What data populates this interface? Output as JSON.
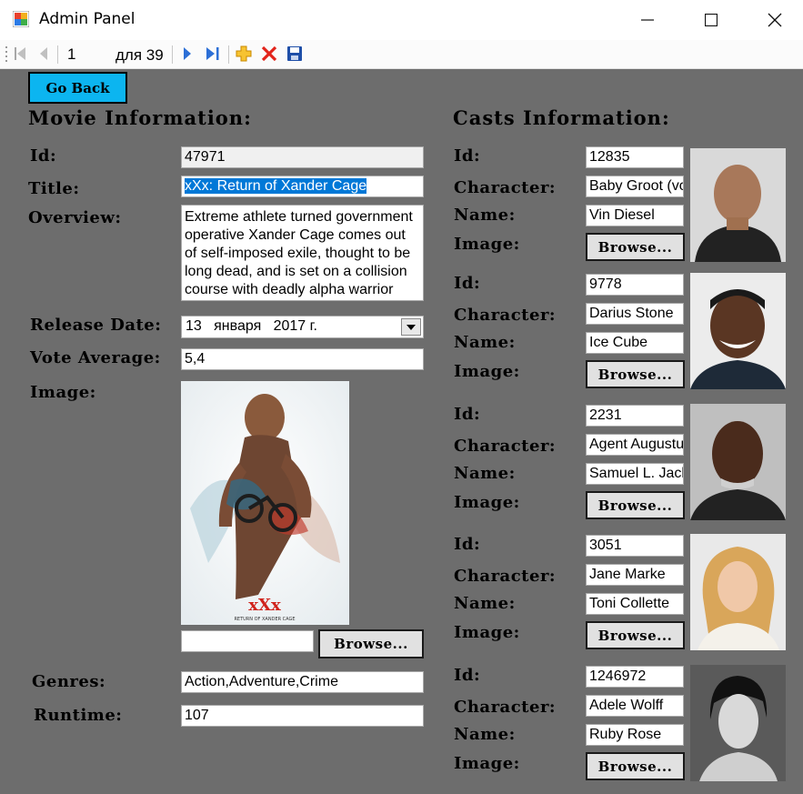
{
  "window": {
    "title": "Admin Panel",
    "minimize": "—",
    "maximize": "☐",
    "close": "✕"
  },
  "toolbar": {
    "position": "1",
    "count_label": "для 39"
  },
  "go_back": "Go Back",
  "movie": {
    "heading": "Movie Information:",
    "id_label": "Id:",
    "id": "47971",
    "title_label": "Title:",
    "title": "xXx: Return of Xander Cage",
    "overview_label": "Overview:",
    "overview": "Extreme athlete turned government operative Xander Cage comes out of self-imposed exile, thought to be long dead, and is set on a collision course with deadly alpha warrior",
    "release_label": "Release Date:",
    "release_date": "13   января   2017 г.",
    "vote_label": "Vote Average:",
    "vote": "5,4",
    "image_label": "Image:",
    "poster_logo": "xXx",
    "poster_caption": "RETURN OF XANDER CAGE",
    "image_path": "",
    "browse": "Browse...",
    "genres_label": "Genres:",
    "genres": "Action,Adventure,Crime",
    "runtime_label": "Runtime:",
    "runtime": "107"
  },
  "casts": {
    "heading": "Casts Information:",
    "id_label": "Id:",
    "character_label": "Character:",
    "name_label": "Name:",
    "image_label": "Image:",
    "browse": "Browse...",
    "items": [
      {
        "id": "12835",
        "character": "Baby Groot (vo",
        "name": "Vin Diesel"
      },
      {
        "id": "9778",
        "character": "Darius Stone",
        "name": "Ice Cube"
      },
      {
        "id": "2231",
        "character": "Agent Augustu",
        "name": "Samuel L. Jack"
      },
      {
        "id": "3051",
        "character": "Jane Marke",
        "name": "Toni Collette"
      },
      {
        "id": "1246972",
        "character": "Adele Wolff",
        "name": "Ruby Rose"
      }
    ]
  },
  "colors": {
    "background": "#6d6d6d",
    "go_back": "#0cb5f0",
    "selection": "#0078d7"
  }
}
